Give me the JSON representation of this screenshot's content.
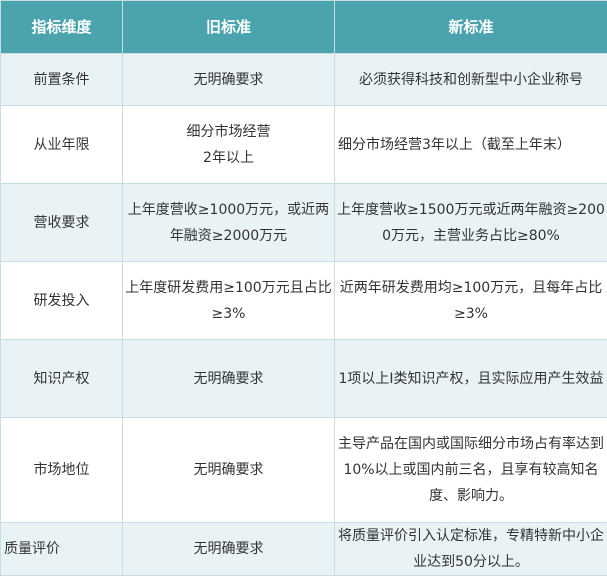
{
  "header": {
    "dimension": "指标维度",
    "old_standard": "旧标准",
    "new_standard": "新标准"
  },
  "rows": [
    {
      "dimension": "前置条件",
      "old": "无明确要求",
      "new": "必须获得科技和创新型中小企业称号"
    },
    {
      "dimension": "从业年限",
      "old_line1": "细分市场经营",
      "old_line2": "2年以上",
      "new": "细分市场经营3年以上（截至上年末）"
    },
    {
      "dimension": "营收要求",
      "old": "上年度营收≥1000万元，或近两年融资≥2000万元",
      "new": "上年度营收≥1500万元或近两年融资≥2000万元，主营业务占比≥80%"
    },
    {
      "dimension": "研发投入",
      "old": "上年度研发费用≥100万元且占比≥3%",
      "new": "近两年研发费用均≥100万元，且每年占比≥3%"
    },
    {
      "dimension": "知识产权",
      "old": "无明确要求",
      "new": "1项以上Ⅰ类知识产权，且实际应用产生效益"
    },
    {
      "dimension": "市场地位",
      "old": "无明确要求",
      "new": "主导产品在国内或国际细分市场占有率达到10%以上或国内前三名，且享有较高知名度、影响力。"
    },
    {
      "dimension": "质量评价",
      "old": "无明确要求",
      "new": "将质量评价引入认定标准，专精特新中小企业达到50分以上。"
    }
  ]
}
